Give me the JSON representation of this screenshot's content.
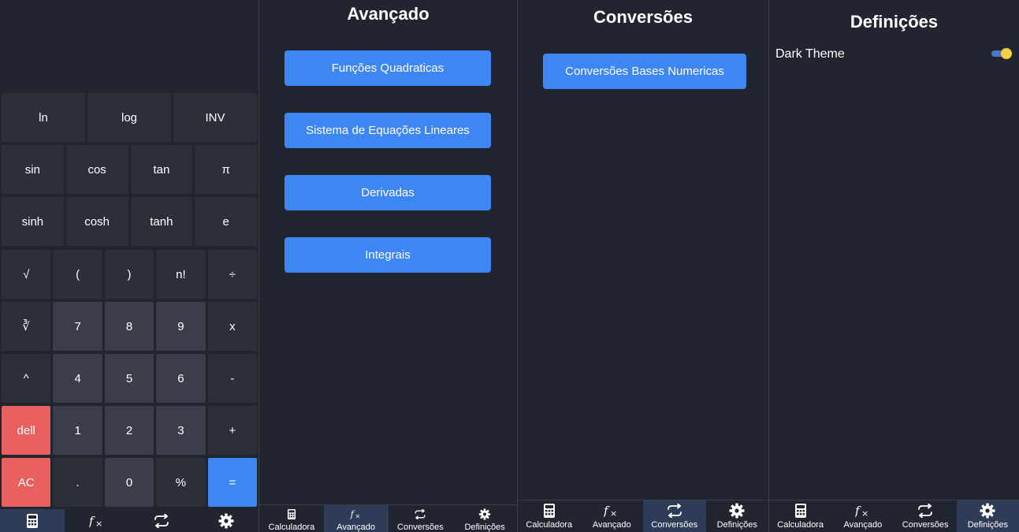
{
  "calculator": {
    "rows": [
      [
        "ln",
        "log",
        "INV"
      ],
      [
        "sin",
        "cos",
        "tan",
        "π"
      ],
      [
        "sinh",
        "cosh",
        "tanh",
        "e"
      ],
      [
        "√",
        "(",
        ")",
        "n!",
        "÷"
      ],
      [
        "∛",
        "7",
        "8",
        "9",
        "x"
      ],
      [
        "^",
        "4",
        "5",
        "6",
        "-"
      ],
      [
        "dell",
        "1",
        "2",
        "3",
        "+"
      ],
      [
        "AC",
        ".",
        "0",
        "%",
        "="
      ]
    ]
  },
  "nav": {
    "calculator": "Calculadora",
    "advanced": "Avançado",
    "conversions": "Conversões",
    "settings": "Definições"
  },
  "icons": {
    "calculator": "calculator-icon",
    "advanced": "function-fx-icon",
    "conversions": "swap-arrows-icon",
    "settings": "gear-icon"
  },
  "advanced": {
    "title": "Avançado",
    "buttons": [
      "Funções Quadraticas",
      "Sistema de Equações Lineares",
      "Derivadas",
      "Integrais"
    ]
  },
  "conversions": {
    "title": "Conversões",
    "button": "Conversões Bases Numericas"
  },
  "settings": {
    "title": "Definições",
    "dark_theme_label": "Dark Theme",
    "dark_theme_enabled": true
  },
  "colors": {
    "background": "#212530",
    "key": "#2b2f38",
    "number_key": "#3a3e49",
    "danger": "#e8605f",
    "accent": "#3f86f5",
    "active_tab": "#2e3c58",
    "toggle_thumb": "#f4d03f"
  }
}
